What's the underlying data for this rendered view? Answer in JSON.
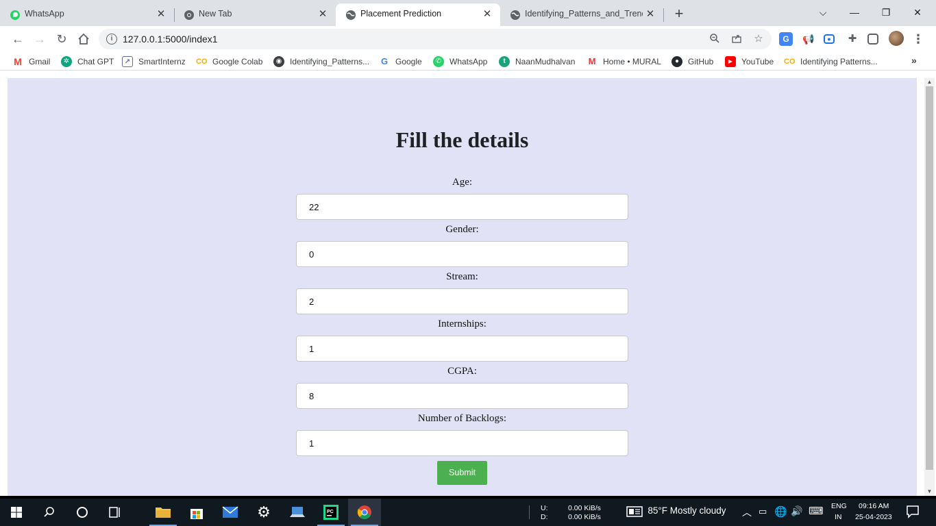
{
  "browser": {
    "tabs": [
      {
        "title": "WhatsApp",
        "icon": "whatsapp-icon"
      },
      {
        "title": "New Tab",
        "icon": "chrome-icon"
      },
      {
        "title": "Placement Prediction",
        "icon": "globe-icon",
        "active": true
      },
      {
        "title": "Identifying_Patterns_and_Trends_",
        "icon": "globe-icon"
      }
    ],
    "url": "127.0.0.1:5000/index1",
    "bookmarks": [
      {
        "label": "Gmail",
        "icon": "gmail-icon",
        "color": "#ea4335"
      },
      {
        "label": "Chat GPT",
        "icon": "openai-icon",
        "color": "#10a37f"
      },
      {
        "label": "SmartInternz",
        "icon": "smartinternz-icon",
        "color": "#5b6b9a"
      },
      {
        "label": "Google Colab",
        "icon": "colab-icon",
        "color": "#f9ab00"
      },
      {
        "label": "Identifying_Patterns...",
        "icon": "globe-icon",
        "color": "#3c4043"
      },
      {
        "label": "Google",
        "icon": "google-icon",
        "color": "#4285f4"
      },
      {
        "label": "WhatsApp",
        "icon": "whatsapp-icon",
        "color": "#25d366"
      },
      {
        "label": "NaanMudhalvan",
        "icon": "naanmudhalvan-icon",
        "color": "#1aa37a"
      },
      {
        "label": "Home • MURAL",
        "icon": "mural-icon",
        "color": "#e8363b"
      },
      {
        "label": "GitHub",
        "icon": "github-icon",
        "color": "#24292f"
      },
      {
        "label": "YouTube",
        "icon": "youtube-icon",
        "color": "#ff0000"
      },
      {
        "label": "Identifying Patterns...",
        "icon": "colab-icon",
        "color": "#f9ab00"
      }
    ]
  },
  "form": {
    "heading": "Fill the details",
    "fields": [
      {
        "label": "Age:",
        "value": "22"
      },
      {
        "label": "Gender:",
        "value": "0"
      },
      {
        "label": "Stream:",
        "value": "2"
      },
      {
        "label": "Internships:",
        "value": "1"
      },
      {
        "label": "CGPA:",
        "value": "8"
      },
      {
        "label": "Number of Backlogs:",
        "value": "1"
      }
    ],
    "submit_label": "Submit",
    "submit_color": "#4caf50",
    "background_color": "#e1e2f6"
  },
  "taskbar": {
    "upload_label": "U:",
    "download_label": "D:",
    "upload_speed": "0.00 KiB/s",
    "download_speed": "0.00 KiB/s",
    "weather": "85°F  Mostly cloudy",
    "language": "ENG",
    "region": "IN",
    "time": "09:16 AM",
    "date": "25-04-2023"
  }
}
